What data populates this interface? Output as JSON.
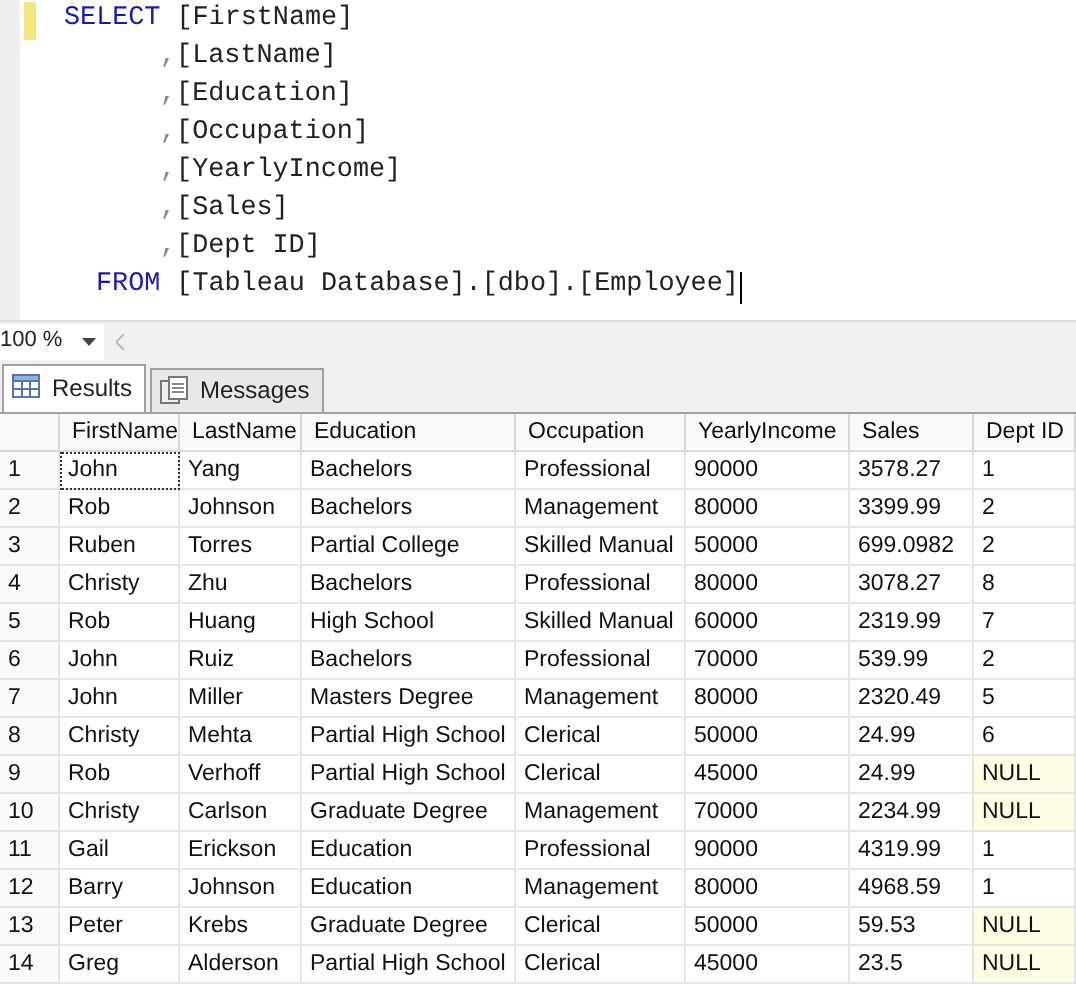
{
  "editor": {
    "lines": [
      {
        "kind": "keyword",
        "keyword": "SELECT",
        "text": "[FirstName]",
        "changed": true
      },
      {
        "kind": "continuation",
        "keyword": ",",
        "text": "[LastName]",
        "changed": false
      },
      {
        "kind": "continuation",
        "keyword": ",",
        "text": "[Education]",
        "changed": false
      },
      {
        "kind": "continuation",
        "keyword": ",",
        "text": "[Occupation]",
        "changed": false
      },
      {
        "kind": "continuation",
        "keyword": ",",
        "text": "[YearlyIncome]",
        "changed": false
      },
      {
        "kind": "continuation",
        "keyword": ",",
        "text": "[Sales]",
        "changed": false
      },
      {
        "kind": "continuation",
        "keyword": ",",
        "text": "[Dept ID]",
        "changed": false
      },
      {
        "kind": "from",
        "keyword": "FROM",
        "text": "[Tableau Database].[dbo].[Employee]",
        "changed": false
      }
    ]
  },
  "zoom": {
    "value": "100 %"
  },
  "tabs": [
    {
      "label": "Results",
      "selected": true,
      "kind": "grid"
    },
    {
      "label": "Messages",
      "selected": false,
      "kind": "messages"
    }
  ],
  "table": {
    "columns": [
      "FirstName",
      "LastName",
      "Education",
      "Occupation",
      "YearlyIncome",
      "Sales",
      "Dept ID"
    ],
    "rows": [
      {
        "number": "1",
        "cells": [
          "John",
          "Yang",
          "Bachelors",
          "Professional",
          "90000",
          "3578.27",
          "1"
        ],
        "focused": true,
        "dept_null": false
      },
      {
        "number": "2",
        "cells": [
          "Rob",
          "Johnson",
          "Bachelors",
          "Management",
          "80000",
          "3399.99",
          "2"
        ],
        "focused": false,
        "dept_null": false
      },
      {
        "number": "3",
        "cells": [
          "Ruben",
          "Torres",
          "Partial College",
          "Skilled Manual",
          "50000",
          "699.0982",
          "2"
        ],
        "focused": false,
        "dept_null": false
      },
      {
        "number": "4",
        "cells": [
          "Christy",
          "Zhu",
          "Bachelors",
          "Professional",
          "80000",
          "3078.27",
          "8"
        ],
        "focused": false,
        "dept_null": false
      },
      {
        "number": "5",
        "cells": [
          "Rob",
          "Huang",
          "High School",
          "Skilled Manual",
          "60000",
          "2319.99",
          "7"
        ],
        "focused": false,
        "dept_null": false
      },
      {
        "number": "6",
        "cells": [
          "John",
          "Ruiz",
          "Bachelors",
          "Professional",
          "70000",
          "539.99",
          "2"
        ],
        "focused": false,
        "dept_null": false
      },
      {
        "number": "7",
        "cells": [
          "John",
          "Miller",
          "Masters Degree",
          "Management",
          "80000",
          "2320.49",
          "5"
        ],
        "focused": false,
        "dept_null": false
      },
      {
        "number": "8",
        "cells": [
          "Christy",
          "Mehta",
          "Partial High School",
          "Clerical",
          "50000",
          "24.99",
          "6"
        ],
        "focused": false,
        "dept_null": false
      },
      {
        "number": "9",
        "cells": [
          "Rob",
          "Verhoff",
          "Partial High School",
          "Clerical",
          "45000",
          "24.99",
          "NULL"
        ],
        "focused": false,
        "dept_null": true
      },
      {
        "number": "10",
        "cells": [
          "Christy",
          "Carlson",
          "Graduate Degree",
          "Management",
          "70000",
          "2234.99",
          "NULL"
        ],
        "focused": false,
        "dept_null": true
      },
      {
        "number": "11",
        "cells": [
          "Gail",
          "Erickson",
          "Education",
          "Professional",
          "90000",
          "4319.99",
          "1"
        ],
        "focused": false,
        "dept_null": false
      },
      {
        "number": "12",
        "cells": [
          "Barry",
          "Johnson",
          "Education",
          "Management",
          "80000",
          "4968.59",
          "1"
        ],
        "focused": false,
        "dept_null": false
      },
      {
        "number": "13",
        "cells": [
          "Peter",
          "Krebs",
          "Graduate Degree",
          "Clerical",
          "50000",
          "59.53",
          "NULL"
        ],
        "focused": false,
        "dept_null": true
      },
      {
        "number": "14",
        "cells": [
          "Greg",
          "Alderson",
          "Partial High School",
          "Clerical",
          "45000",
          "23.5",
          "NULL"
        ],
        "focused": false,
        "dept_null": true
      }
    ]
  }
}
